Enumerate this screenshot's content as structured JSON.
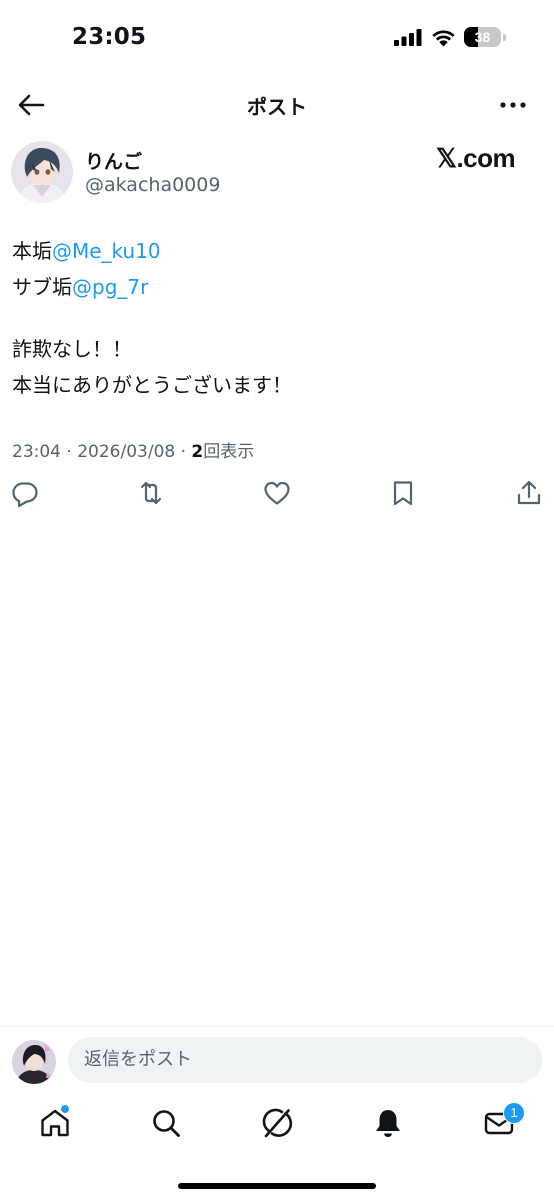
{
  "status_bar": {
    "time": "23:05",
    "battery_level": "38",
    "battery_fraction": 0.38,
    "signal_icon": "signal-icon",
    "wifi_icon": "wifi-icon"
  },
  "header": {
    "title": "ポスト",
    "back_icon": "back-arrow-icon",
    "more_icon": "more-icon"
  },
  "post": {
    "author": {
      "display_name": "りんご",
      "handle": "@akacha0009"
    },
    "watermark": "𝕏.com",
    "body": {
      "line1_prefix": "本垢",
      "line1_mention": "@Me_ku10",
      "line2_prefix": "サブ垢",
      "line2_mention": "@pg_7r",
      "line3": "詐欺なし！！",
      "line4": "本当にありがとうございます！"
    },
    "meta": {
      "time": "23:04",
      "separator": " · ",
      "date": "2026/03/08",
      "views_count": "2",
      "views_label": "回表示"
    },
    "actions": {
      "reply_icon": "reply-icon",
      "repost_icon": "repost-icon",
      "like_icon": "like-icon",
      "bookmark_icon": "bookmark-icon",
      "share_icon": "share-icon"
    }
  },
  "reply_bar": {
    "placeholder": "返信をポスト"
  },
  "tab_bar": {
    "items": [
      "home-icon",
      "search-icon",
      "grok-icon",
      "notifications-icon",
      "messages-icon"
    ],
    "messages_badge": "1"
  },
  "colors": {
    "accent": "#1d9bf0",
    "text": "#0f1419",
    "secondary_text": "#536471",
    "input_bg": "#eff3f4"
  }
}
